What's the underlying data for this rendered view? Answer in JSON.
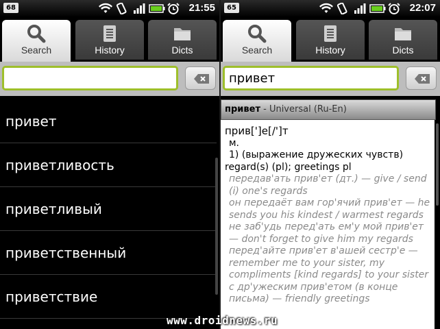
{
  "left": {
    "status": {
      "badge": "68",
      "time": "21:55"
    },
    "tabs": [
      {
        "label": "Search",
        "icon": "search-icon",
        "active": true
      },
      {
        "label": "History",
        "icon": "history-icon",
        "active": false
      },
      {
        "label": "Dicts",
        "icon": "folder-icon",
        "active": false
      }
    ],
    "search": {
      "value": ""
    },
    "suggestions": [
      "привет",
      "приветливость",
      "приветливый",
      "приветственный",
      "приветствие"
    ]
  },
  "right": {
    "status": {
      "badge": "65",
      "time": "22:07"
    },
    "tabs": [
      {
        "label": "Search",
        "icon": "search-icon",
        "active": true
      },
      {
        "label": "History",
        "icon": "history-icon",
        "active": false
      },
      {
        "label": "Dicts",
        "icon": "folder-icon",
        "active": false
      }
    ],
    "search": {
      "value": "привет"
    },
    "article": {
      "word": "привет",
      "source": " - Universal (Ru-En)",
      "headword": "прив[']е[/']т",
      "gender": "м.",
      "sense": "1) (выражение дружеских чувств)",
      "translation": "regard(s) (pl); greetings pl",
      "examples": [
        "передав'ать прив'ет (дт.) — give / send (i) one's regards",
        "он передаёт вам гор'ячий прив'ет — he sends you his kindest / warmest regards",
        "не заб'удь перед'ать ем'у мой прив'ет — don't forget to give him my regards",
        "перед'айте прив'ет в'ашей сестр'е — remember me to your sister, my compliments [kind regards] to your sister",
        "с др'ужеским прив'етом (в конце письма) — friendly greetings"
      ]
    }
  },
  "watermark": "www.droidnews.ru",
  "colors": {
    "accent": "#9ebf2a",
    "example_text": "#8a8a8a"
  }
}
